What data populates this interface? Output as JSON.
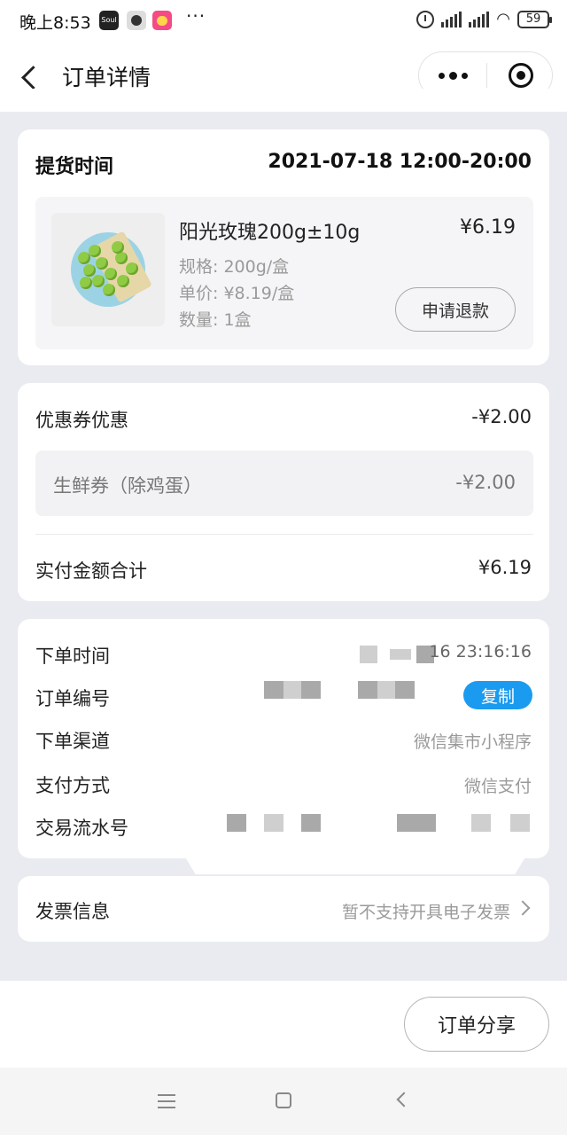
{
  "status_bar": {
    "time": "晚上8:53",
    "app1": "Soul",
    "more": "···",
    "battery": "59"
  },
  "nav": {
    "title": "订单详情"
  },
  "pickup": {
    "label": "提货时间",
    "time": "2021-07-18 12:00-20:00"
  },
  "product": {
    "name": "阳光玫瑰200g±10g",
    "price": "¥6.19",
    "spec": "规格: 200g/盒",
    "unit_price": "单价: ¥8.19/盒",
    "quantity": "数量: 1盒",
    "refund_label": "申请退款"
  },
  "coupon": {
    "label": "优惠券优惠",
    "amount": "-¥2.00",
    "item_name": "生鲜券（除鸡蛋）",
    "item_amount": "-¥2.00",
    "total_label": "实付金额合计",
    "total_amount": "¥6.19"
  },
  "order_info": {
    "time_label": "下单时间",
    "time_value": "16 23:16:16",
    "number_label": "订单编号",
    "copy_label": "复制",
    "channel_label": "下单渠道",
    "channel_value": "微信集市小程序",
    "payment_label": "支付方式",
    "payment_value": "微信支付",
    "txn_label": "交易流水号"
  },
  "invoice": {
    "label": "发票信息",
    "value": "暂不支持开具电子发票"
  },
  "bottom": {
    "share_label": "订单分享"
  }
}
